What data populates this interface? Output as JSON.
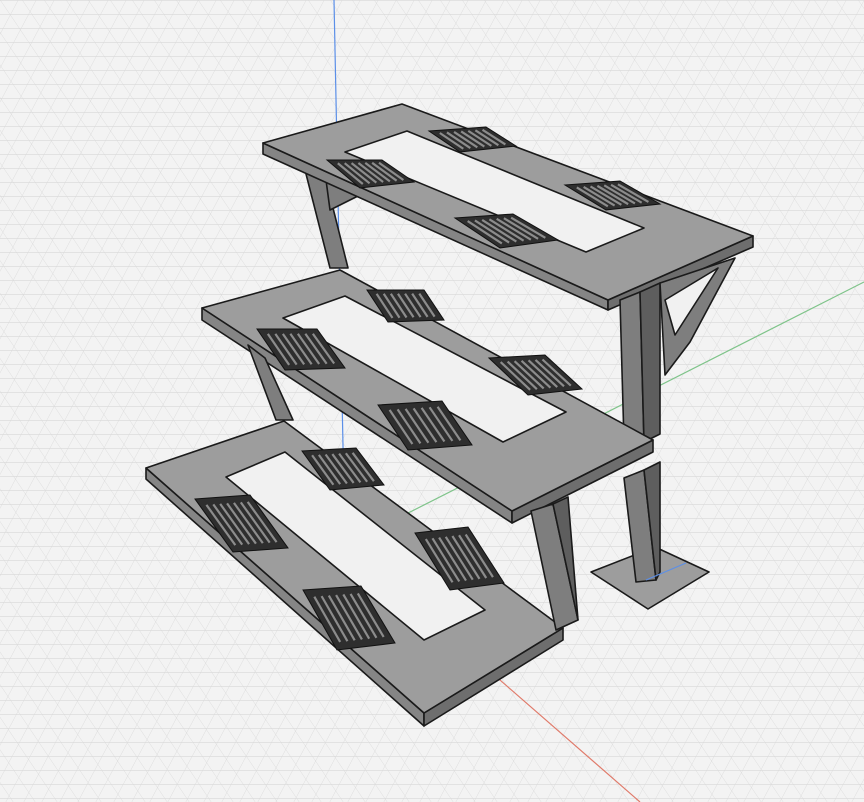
{
  "viewport": {
    "background": "#f3f3f3",
    "grid_color": "#d6d6d6",
    "grid_major_color": "#c8c8c8",
    "axes": {
      "x_color": "#e07a6a",
      "y_color": "#7fc48a",
      "z_color": "#5b8fe8"
    }
  },
  "model": {
    "kind": "three-tier stepped display stand",
    "face_color": "#9d9d9d",
    "edge_color": "#1a1a1a",
    "tiers": 3,
    "vents_per_tier": 4
  }
}
